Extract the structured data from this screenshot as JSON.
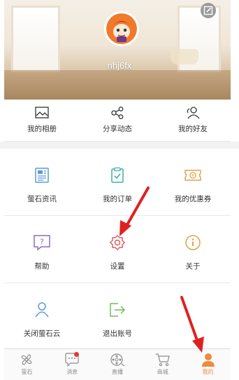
{
  "profile": {
    "username": "nhj6fx"
  },
  "quick_actions": [
    {
      "label": "我的相册",
      "icon": "photo-album-icon"
    },
    {
      "label": "分享动态",
      "icon": "share-icon"
    },
    {
      "label": "我的好友",
      "icon": "friends-icon"
    }
  ],
  "menu": [
    {
      "label": "萤石资讯",
      "icon": "news-icon"
    },
    {
      "label": "我的订单",
      "icon": "orders-icon"
    },
    {
      "label": "我的优惠券",
      "icon": "coupon-icon"
    },
    {
      "label": "帮助",
      "icon": "help-icon"
    },
    {
      "label": "设置",
      "icon": "settings-icon"
    },
    {
      "label": "关于",
      "icon": "about-icon"
    },
    {
      "label": "关闭萤石云",
      "icon": "close-cloud-icon"
    },
    {
      "label": "退出账号",
      "icon": "logout-icon"
    }
  ],
  "bottom_nav": [
    {
      "label": "萤石",
      "icon": "fan-icon"
    },
    {
      "label": "消息",
      "icon": "message-icon",
      "badge": true
    },
    {
      "label": "直播",
      "icon": "live-icon"
    },
    {
      "label": "商城",
      "icon": "cart-icon"
    },
    {
      "label": "我的",
      "icon": "user-icon",
      "active": true
    }
  ],
  "colors": {
    "accent": "#f08a3e",
    "icon_blue": "#5b9bd5",
    "icon_teal": "#3fb0a6",
    "icon_orange": "#e0a24a",
    "icon_purple": "#8e6bbf",
    "icon_red": "#d96060",
    "icon_green": "#6bbf5a",
    "annotation_arrow": "#e02020"
  }
}
